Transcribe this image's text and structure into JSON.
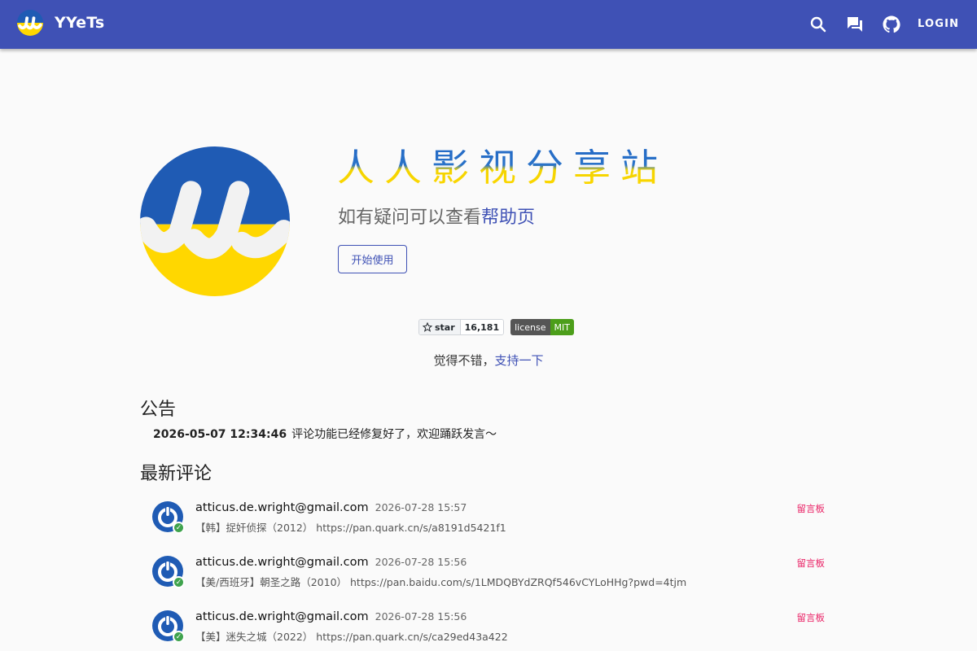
{
  "appbar": {
    "brand": "YYeTs",
    "login_label": "LOGIN",
    "icons": [
      "search-icon",
      "forum-icon",
      "github-icon"
    ],
    "color": "#3f51b5"
  },
  "hero": {
    "title": "人人影视分享站",
    "subtitle_prefix": "如有疑问可以查看",
    "subtitle_link": "帮助页",
    "start_button": "开始使用"
  },
  "badges": {
    "star_label": "star",
    "star_count": "16,181",
    "license_label": "license",
    "license_value": "MIT"
  },
  "support": {
    "prefix": "觉得不错，",
    "link": "支持一下"
  },
  "announcement": {
    "title": "公告",
    "time": "2026-05-07 12:34:46",
    "text": "评论功能已经修复好了，欢迎踊跃发言～"
  },
  "comments": {
    "title": "最新评论",
    "items": [
      {
        "user": "atticus.de.wright@gmail.com",
        "time": "2026-07-28 15:57",
        "text": "【韩】捉奸侦探（2012） https://pan.quark.cn/s/a8191d5421f1",
        "board": "留言板"
      },
      {
        "user": "atticus.de.wright@gmail.com",
        "time": "2026-07-28 15:56",
        "text": "【美/西班牙】朝圣之路（2010） https://pan.baidu.com/s/1LMDQBYdZRQf546vCYLoHHg?pwd=4tjm",
        "board": "留言板"
      },
      {
        "user": "atticus.de.wright@gmail.com",
        "time": "2026-07-28 15:56",
        "text": "【美】迷失之城（2022） https://pan.quark.cn/s/ca29ed43a422",
        "board": "留言板"
      }
    ]
  }
}
